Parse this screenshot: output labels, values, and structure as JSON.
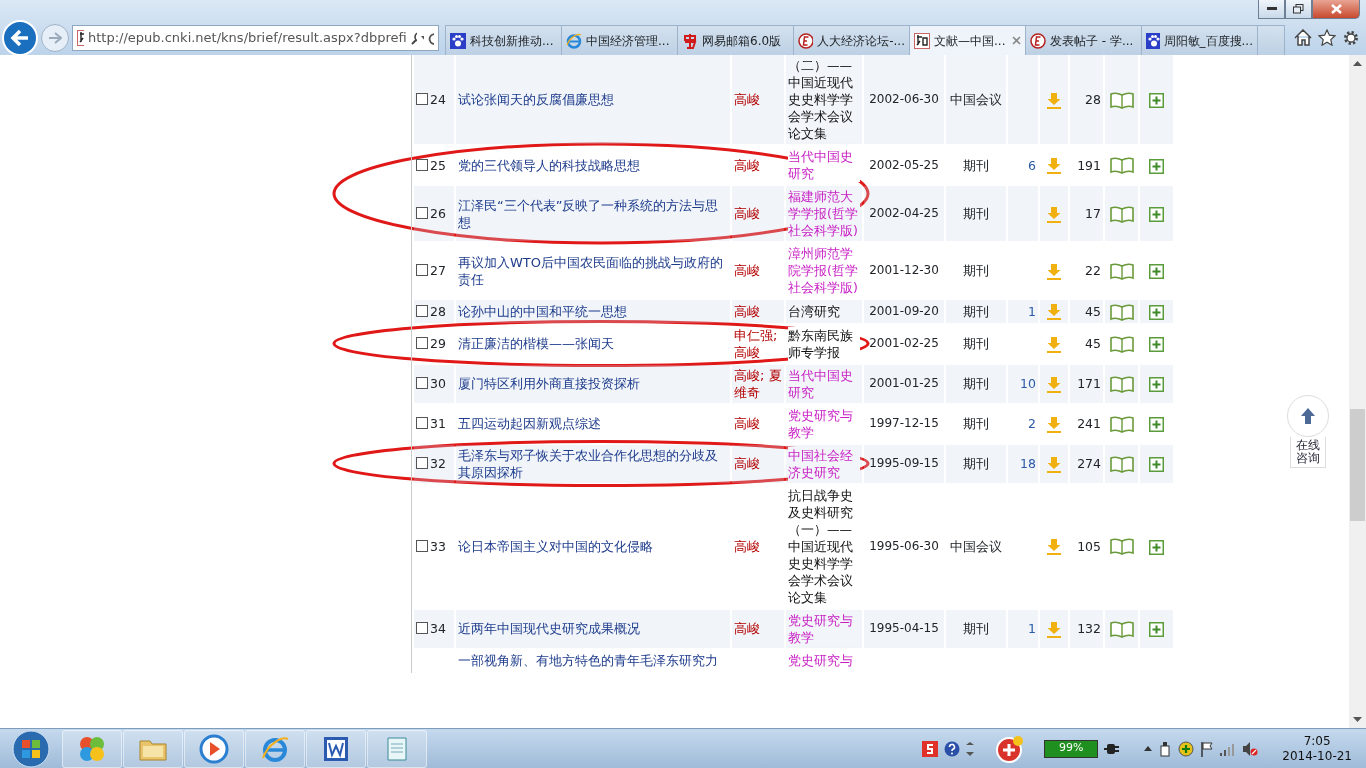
{
  "browser": {
    "address": "http://epub.cnki.net/kns/brief/result.aspx?dbprefi",
    "tabs": [
      {
        "title": "科技创新推动...",
        "kind": "paw",
        "selected": false
      },
      {
        "title": "中国经济管理...",
        "kind": "ie",
        "selected": false
      },
      {
        "title": "网易邮箱6.0版",
        "kind": "mail",
        "selected": false
      },
      {
        "title": "人大经济论坛-...",
        "kind": "e",
        "selected": false
      },
      {
        "title": "文献—中国...",
        "kind": "cnki",
        "selected": true
      },
      {
        "title": "发表帖子 - 学...",
        "kind": "e",
        "selected": false
      },
      {
        "title": "周阳敏_百度搜...",
        "kind": "paw",
        "selected": false
      }
    ]
  },
  "results": {
    "rows": [
      {
        "number": "24",
        "checked": false,
        "title": "试论张闻天的反腐倡廉思想",
        "authors": "高峻",
        "journal": "（二）——中国近现代史史料学学会学术会议论文集",
        "linked": false,
        "date": "2002-06-30",
        "type": "中国会议",
        "downloads": "28",
        "circled": false
      },
      {
        "number": "25",
        "checked": false,
        "title": "党的三代领导人的科技战略思想",
        "authors": "高峻",
        "journal": "当代中国史研究",
        "linked": true,
        "date": "2002-05-25",
        "type": "期刊",
        "cited": "6",
        "downloads": "191",
        "circled": true
      },
      {
        "number": "26",
        "checked": false,
        "title": "江泽民“三个代表”反映了一种系统的方法与思想",
        "authors": "高峻",
        "journal": "福建师范大学学报(哲学社会科学版)",
        "linked": true,
        "date": "2002-04-25",
        "type": "期刊",
        "downloads": "17",
        "circled": true
      },
      {
        "number": "27",
        "checked": false,
        "title": "再议加入WTO后中国农民面临的挑战与政府的责任",
        "authors": "高峻",
        "journal": "漳州师范学院学报(哲学社会科学版)",
        "linked": true,
        "date": "2001-12-30",
        "type": "期刊",
        "downloads": "22",
        "circled": false
      },
      {
        "number": "28",
        "checked": false,
        "title": "论孙中山的中国和平统一思想",
        "authors": "高峻",
        "journal": "台湾研究",
        "linked": false,
        "date": "2001-09-20",
        "type": "期刊",
        "cited": "1",
        "downloads": "45",
        "circled": false
      },
      {
        "number": "29",
        "checked": false,
        "title": "清正廉洁的楷模——张闻天",
        "authors": "申仁强; 高峻",
        "journal": "黔东南民族师专学报",
        "linked": false,
        "date": "2001-02-25",
        "type": "期刊",
        "downloads": "45",
        "circled": true
      },
      {
        "number": "30",
        "checked": false,
        "title": "厦门特区利用外商直接投资探析",
        "authors": "高峻; 夏维奇",
        "journal": "当代中国史研究",
        "linked": true,
        "date": "2001-01-25",
        "type": "期刊",
        "cited": "10",
        "downloads": "171",
        "circled": false
      },
      {
        "number": "31",
        "checked": false,
        "title": "五四运动起因新观点综述",
        "authors": "高峻",
        "journal": "党史研究与教学",
        "linked": true,
        "date": "1997-12-15",
        "type": "期刊",
        "cited": "2",
        "downloads": "241",
        "circled": false
      },
      {
        "number": "32",
        "checked": false,
        "title": "毛泽东与邓子恢关于农业合作化思想的分歧及其原因探析",
        "authors": "高峻",
        "journal": "中国社会经济史研究",
        "linked": true,
        "date": "1995-09-15",
        "type": "期刊",
        "cited": "18",
        "downloads": "274",
        "circled": true
      },
      {
        "number": "33",
        "checked": false,
        "title": "论日本帝国主义对中国的文化侵略",
        "authors": "高峻",
        "journal": "抗日战争史及史料研究（一）——中国近现代史史料学学会学术会议论文集",
        "linked": false,
        "date": "1995-06-30",
        "type": "中国会议",
        "downloads": "105",
        "circled": false
      },
      {
        "number": "34",
        "checked": false,
        "title": "近两年中国现代史研究成果概况",
        "authors": "高峻",
        "journal": "党史研究与教学",
        "linked": true,
        "date": "1995-04-15",
        "type": "期刊",
        "cited": "1",
        "downloads": "132",
        "circled": false
      },
      {
        "title": "一部视角新、有地方特色的青年毛泽东研究力",
        "journal": "党史研究与",
        "linked": true,
        "circled": false
      }
    ]
  },
  "consult": {
    "label": "在线咨询"
  },
  "taskbar": {
    "apps": [
      {
        "kind": "office"
      },
      {
        "kind": "folder"
      },
      {
        "kind": "player"
      },
      {
        "kind": "ie"
      },
      {
        "kind": "word"
      },
      {
        "kind": "notepad"
      }
    ],
    "battery": "99%",
    "time": "7:05",
    "date": "2014-10-21"
  }
}
